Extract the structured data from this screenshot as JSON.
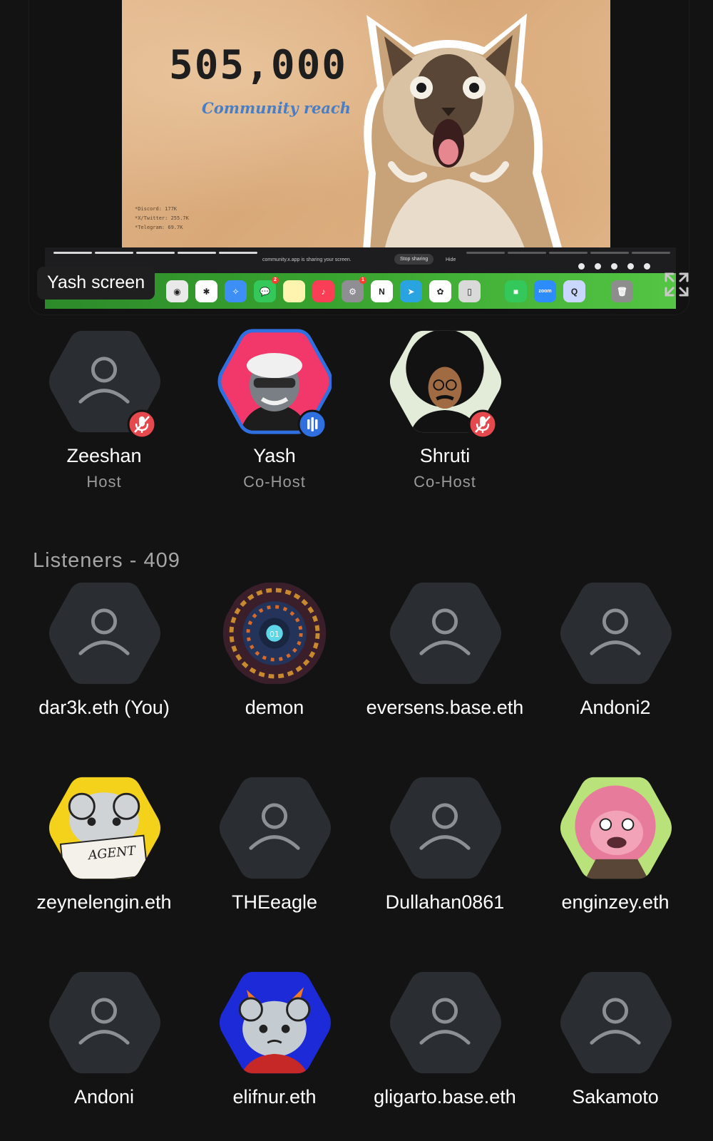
{
  "screen_share": {
    "label": "Yash screen",
    "slide": {
      "stat": "505,000",
      "caption": "Community reach",
      "notes": [
        "*Discord: 177K",
        "*X/Twitter: 255.7K",
        "*Telegram: 69.7K"
      ]
    },
    "mac_bar": {
      "share_message": "community.x.app is sharing your screen.",
      "stop_sharing": "Stop sharing",
      "hide": "Hide"
    },
    "dock_apps": [
      {
        "name": "chrome",
        "color": "#e9e9e9",
        "glyph": "◉"
      },
      {
        "name": "slack",
        "color": "#ffffff",
        "glyph": "✱"
      },
      {
        "name": "safari",
        "color": "#3d8ff5",
        "glyph": "✧"
      },
      {
        "name": "messages",
        "color": "#34c759",
        "glyph": "💬",
        "badge": "2"
      },
      {
        "name": "notes",
        "color": "#fff3b0",
        "glyph": ""
      },
      {
        "name": "music",
        "color": "#fa3e55",
        "glyph": "♪"
      },
      {
        "name": "settings",
        "color": "#8e8e93",
        "glyph": "⚙",
        "badge": "1"
      },
      {
        "name": "notion",
        "color": "#ffffff",
        "glyph": "N"
      },
      {
        "name": "telegram",
        "color": "#2aa4e0",
        "glyph": "➤"
      },
      {
        "name": "chatgpt",
        "color": "#ffffff",
        "glyph": "✿"
      },
      {
        "name": "iphone-mirroring",
        "color": "#d9d9d9",
        "glyph": "▯"
      },
      {
        "name": "facetime",
        "color": "#34c759",
        "glyph": "■"
      },
      {
        "name": "zoom",
        "color": "#2d8cff",
        "glyph": "zoom"
      },
      {
        "name": "quicktime",
        "color": "#c9d7ff",
        "glyph": "Q"
      },
      {
        "name": "trash",
        "color": "#8d8d8d",
        "glyph": "🗑"
      }
    ]
  },
  "speakers": [
    {
      "name": "Zeeshan",
      "role": "Host",
      "avatar": "default",
      "status": "muted"
    },
    {
      "name": "Yash",
      "role": "Co-Host",
      "avatar": "ape-nft",
      "status": "speaking"
    },
    {
      "name": "Shruti",
      "role": "Co-Host",
      "avatar": "afro-portrait",
      "status": "muted"
    }
  ],
  "listeners_section": {
    "title": "Listeners - 409"
  },
  "listeners": [
    {
      "name": "dar3k.eth (You)",
      "avatar": "default"
    },
    {
      "name": "demon",
      "avatar": "mandala-nft"
    },
    {
      "name": "eversens.base.eth",
      "avatar": "default"
    },
    {
      "name": "Andoni2",
      "avatar": "default"
    },
    {
      "name": "zeynelengin.eth",
      "avatar": "agent-cat-nft"
    },
    {
      "name": "THEeagle",
      "avatar": "default"
    },
    {
      "name": "Dullahan0861",
      "avatar": "default"
    },
    {
      "name": "enginzey.eth",
      "avatar": "pink-lion-nft"
    },
    {
      "name": "Andoni",
      "avatar": "default"
    },
    {
      "name": "elifnur.eth",
      "avatar": "punk-cat-nft"
    },
    {
      "name": "gligarto.base.eth",
      "avatar": "default"
    },
    {
      "name": "Sakamoto",
      "avatar": "default"
    }
  ],
  "colors": {
    "background": "#131313",
    "avatar_default": "#2a2d31",
    "muted_badge": "#e5484d",
    "speaking_badge": "#2f6fe0",
    "speaking_ring": "#2f6fe0"
  }
}
